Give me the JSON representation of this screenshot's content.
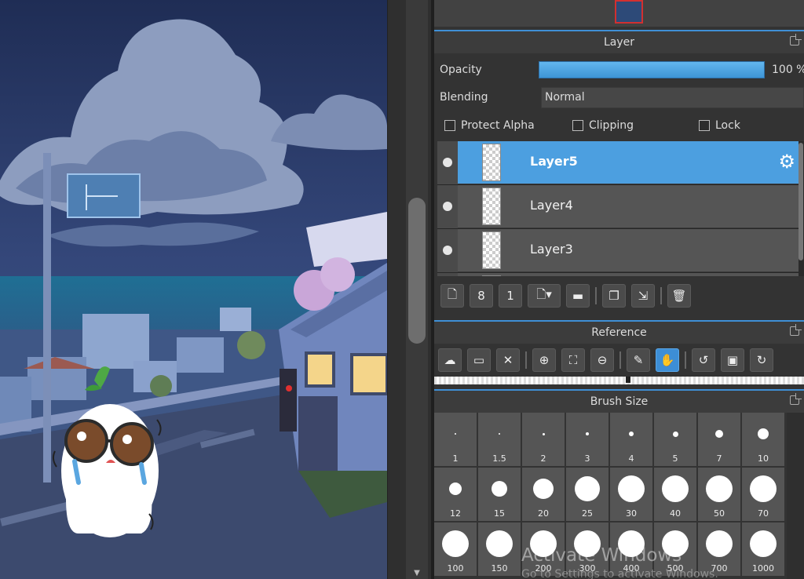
{
  "colors": {
    "accent": "#3f8fd6",
    "selected_layer": "#4c9fe0",
    "panel_bg": "#333333"
  },
  "layer_panel": {
    "title": "Layer",
    "opacity_label": "Opacity",
    "opacity_value": "100 %",
    "opacity_fraction": 1.0,
    "blending_label": "Blending",
    "blending_value": "Normal",
    "protect_alpha_label": "Protect Alpha",
    "clipping_label": "Clipping",
    "lock_label": "Lock",
    "layers": [
      {
        "name": "Layer5",
        "selected": true
      },
      {
        "name": "Layer4",
        "selected": false
      },
      {
        "name": "Layer3",
        "selected": false
      }
    ],
    "toolbar_icons": [
      "new-layer-icon",
      "new-8bit-layer-icon",
      "new-1bit-layer-icon",
      "add-layer-menu-icon",
      "folder-icon",
      "duplicate-layer-icon",
      "merge-layer-icon",
      "delete-layer-icon"
    ]
  },
  "reference_panel": {
    "title": "Reference",
    "toolbar_icons": [
      "import-cloud-icon",
      "open-folder-icon",
      "close-icon",
      "zoom-in-icon",
      "fit-icon",
      "zoom-out-icon",
      "eyedropper-icon",
      "hand-icon",
      "rotate-left-icon",
      "reset-icon",
      "rotate-right-icon",
      "flip-icon"
    ]
  },
  "brush_panel": {
    "title": "Brush Size",
    "sizes": [
      "1",
      "1.5",
      "2",
      "3",
      "4",
      "5",
      "7",
      "10",
      "12",
      "15",
      "20",
      "25",
      "30",
      "40",
      "50",
      "70",
      "100",
      "150",
      "200",
      "300",
      "400",
      "500",
      "700",
      "1000"
    ]
  },
  "watermark": {
    "line1": "Activate Windows",
    "line2": "Go to Settings to activate Windows."
  }
}
